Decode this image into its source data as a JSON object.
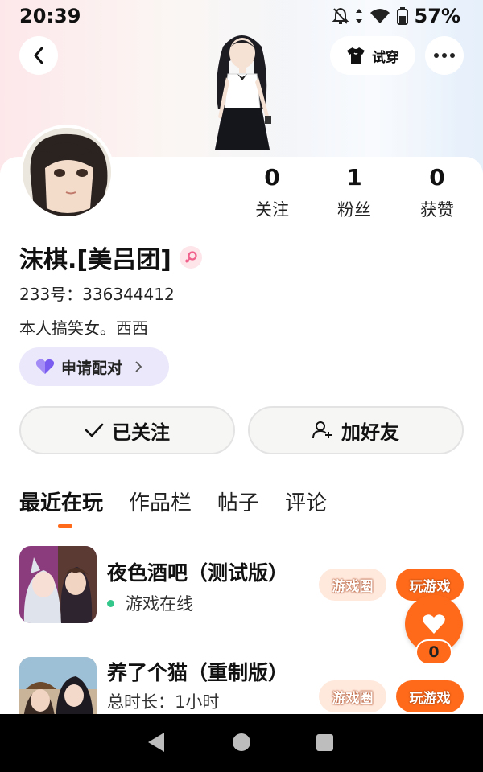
{
  "status_bar": {
    "time": "20:39",
    "battery": "57%"
  },
  "header": {
    "try_on_label": "试穿"
  },
  "profile": {
    "stats": [
      {
        "value": "0",
        "label": "关注"
      },
      {
        "value": "1",
        "label": "粉丝"
      },
      {
        "value": "0",
        "label": "获赞"
      }
    ],
    "name": "沫棋.[美吕团]",
    "gender": "female",
    "id_line": "233号：336344412",
    "bio": "本人搞笑女。西西",
    "match_button_label": "申请配对",
    "follow_button_label": "已关注",
    "add_friend_button_label": "加好友"
  },
  "tabs": [
    {
      "label": "最近在玩",
      "active": true
    },
    {
      "label": "作品栏",
      "active": false
    },
    {
      "label": "帖子",
      "active": false
    },
    {
      "label": "评论",
      "active": false
    }
  ],
  "games": [
    {
      "title": "夜色酒吧（测试版）",
      "subtitle": "游戏在线",
      "online": true,
      "circle_label": "游戏圈",
      "play_label": "玩游戏"
    },
    {
      "title": "养了个猫（重制版）",
      "subtitle": "总时长：1小时",
      "online": false,
      "circle_label": "游戏圈",
      "play_label": "玩游戏"
    }
  ],
  "like_fab": {
    "count": "0"
  },
  "colors": {
    "accent": "#ff6a1a",
    "match_bg": "#ebe8fb",
    "online_dot": "#34c78b"
  }
}
